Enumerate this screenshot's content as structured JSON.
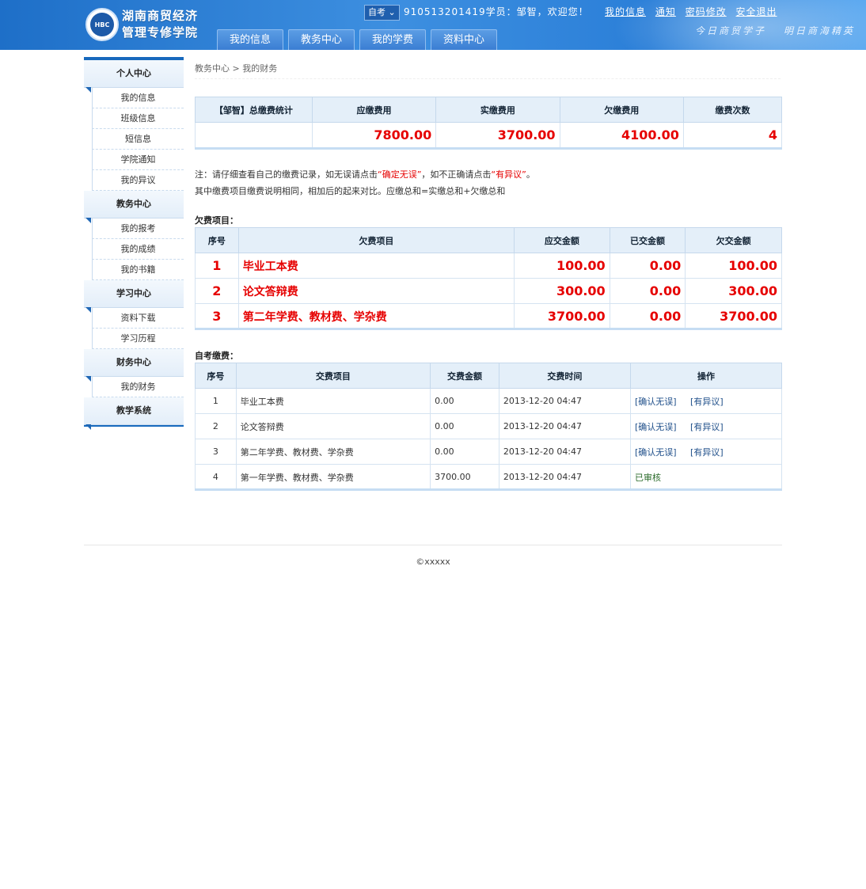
{
  "header": {
    "logo_line1": "湖南商贸经济",
    "logo_line2": "管理专修学院",
    "logo_seal_text": "HBC",
    "exam_type": "自考",
    "welcome": "910513201419学员：邹智，欢迎您！",
    "links": [
      "我的信息",
      "通知",
      "密码修改",
      "安全退出"
    ],
    "slogans": [
      "今日商贸学子",
      "明日商海精英"
    ],
    "nav_tabs": [
      "我的信息",
      "教务中心",
      "我的学费",
      "资料中心"
    ]
  },
  "sidebar": {
    "sections": [
      {
        "title": "个人中心",
        "items": [
          "我的信息",
          "班级信息",
          "短信息",
          "学院通知",
          "我的异议"
        ]
      },
      {
        "title": "教务中心",
        "items": [
          "我的报考",
          "我的成绩",
          "我的书籍"
        ]
      },
      {
        "title": "学习中心",
        "items": [
          "资料下载",
          "学习历程"
        ]
      },
      {
        "title": "财务中心",
        "items": [
          "我的财务"
        ]
      },
      {
        "title": "教学系统",
        "items": []
      }
    ]
  },
  "breadcrumb": {
    "part1": "教务中心",
    "sep": ">",
    "part2": "我的财务"
  },
  "summary": {
    "headers": [
      "【邹智】总缴费统计",
      "应缴费用",
      "实缴费用",
      "欠缴费用",
      "缴费次数"
    ],
    "values": [
      "",
      "7800.00",
      "3700.00",
      "4100.00",
      "4"
    ]
  },
  "note": {
    "line1_a": "注：请仔细查看自己的缴费记录，如无误请点击",
    "line1_b": "“确定无误”",
    "line1_c": "，如不正确请点击",
    "line1_d": "“有异议”",
    "line1_e": "。",
    "line2": "其中缴费项目缴费说明相同，相加后的起来对比。应缴总和=实缴总和+欠缴总和"
  },
  "arrears": {
    "title": "欠费项目：",
    "headers": [
      "序号",
      "欠费项目",
      "应交金额",
      "已交金额",
      "欠交金额"
    ],
    "rows": [
      {
        "no": "1",
        "item": "毕业工本费",
        "due": "100.00",
        "paid": "0.00",
        "owed": "100.00"
      },
      {
        "no": "2",
        "item": "论文答辩费",
        "due": "300.00",
        "paid": "0.00",
        "owed": "300.00"
      },
      {
        "no": "3",
        "item": "第二年学费、教材费、学杂费",
        "due": "3700.00",
        "paid": "0.00",
        "owed": "3700.00"
      }
    ]
  },
  "payments": {
    "title": "自考缴费：",
    "headers": [
      "序号",
      "交费项目",
      "交费金额",
      "交费时间",
      "操作"
    ],
    "confirm_label": "[确认无误]",
    "dispute_label": "[有异议]",
    "rows": [
      {
        "no": "1",
        "item": "毕业工本费",
        "amount": "0.00",
        "time": "2013-12-20 04:47",
        "status": ""
      },
      {
        "no": "2",
        "item": "论文答辩费",
        "amount": "0.00",
        "time": "2013-12-20 04:47",
        "status": ""
      },
      {
        "no": "3",
        "item": "第二年学费、教材费、学杂费",
        "amount": "0.00",
        "time": "2013-12-20 04:47",
        "status": ""
      },
      {
        "no": "4",
        "item": "第一年学费、教材费、学杂费",
        "amount": "3700.00",
        "time": "2013-12-20 04:47",
        "status": "已审核"
      }
    ]
  },
  "footer": {
    "copyright": "©xxxxx"
  }
}
